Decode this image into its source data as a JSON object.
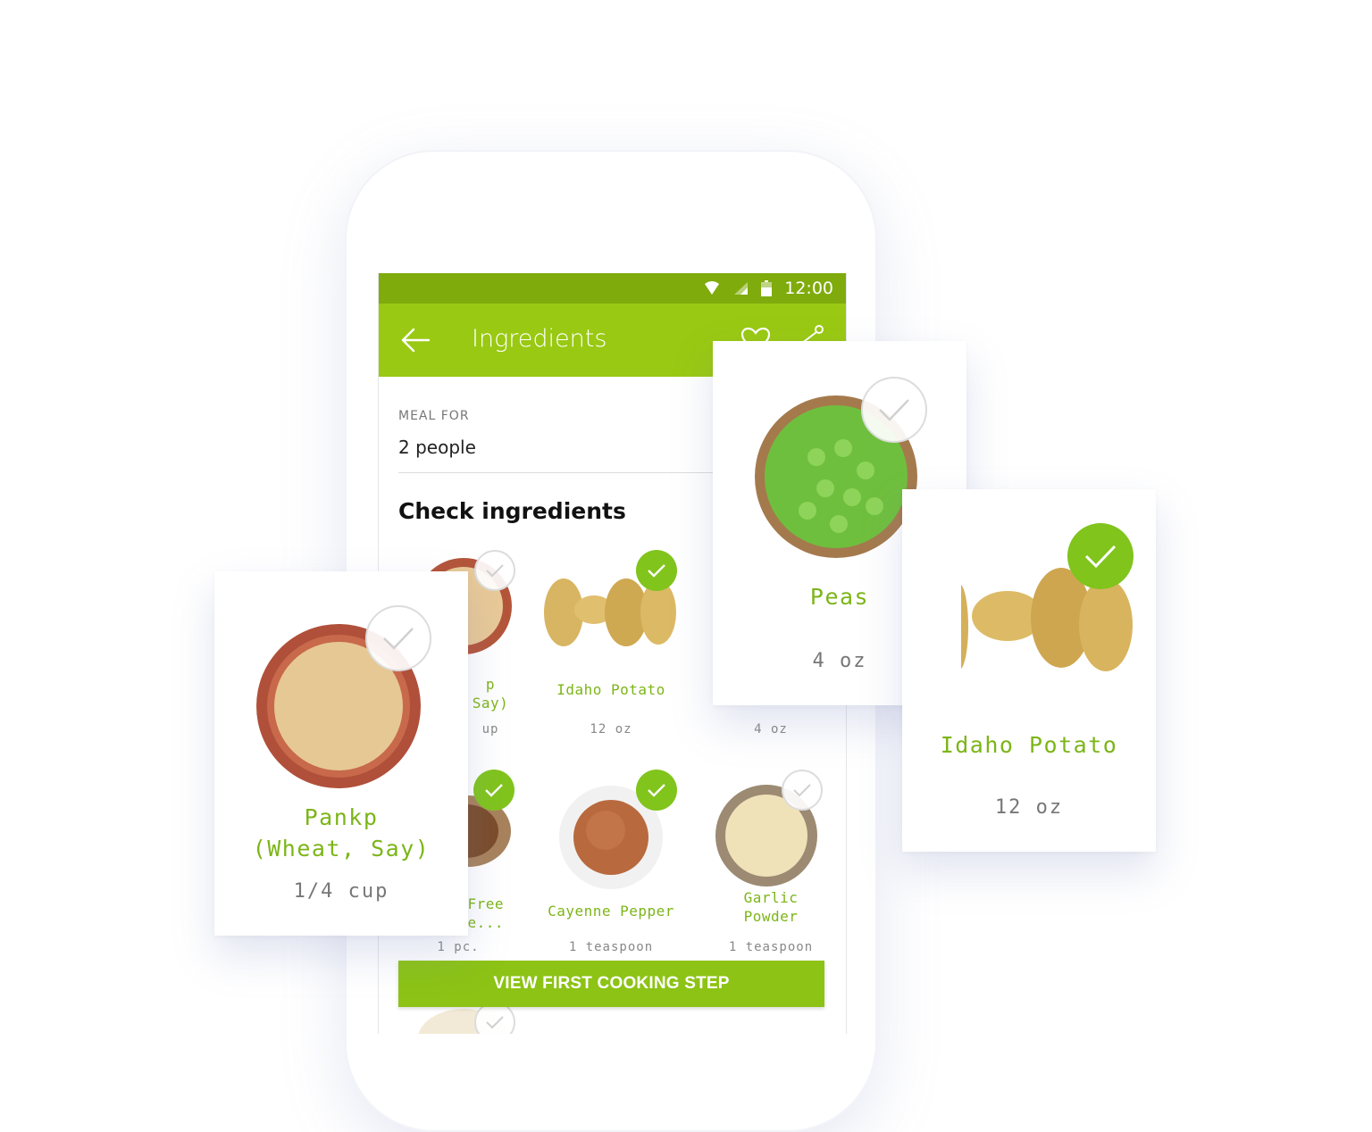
{
  "status_bar": {
    "time": "12:00"
  },
  "app_bar": {
    "title": "Ingredients"
  },
  "meal": {
    "label": "MEAL FOR",
    "value": "2 people"
  },
  "section_title": "Check ingredients",
  "grid_items": [
    {
      "name": "Pankp (Wheat, Say)",
      "qty": "1/4 cup",
      "checked": false
    },
    {
      "name": "Idaho Potato",
      "qty": "12 oz",
      "checked": true
    },
    {
      "name": "Peas",
      "qty": "4 oz",
      "checked": false
    },
    {
      "name": "Gluten Free Soy Sauce...",
      "qty": "1 pc.",
      "checked": true
    },
    {
      "name": "Cayenne Pepper",
      "qty": "1 teaspoon",
      "checked": true
    },
    {
      "name": "Garlic Powder",
      "qty": "1 teaspoon",
      "checked": false
    }
  ],
  "grid_text": {
    "pankp_name_line1": "p",
    "pankp_name_line2": "Say)",
    "pankp_qty": "up",
    "soy_name_line1": "Free",
    "soy_name_line2": "nce...",
    "garlic_line1": "Garlic",
    "garlic_line2": "Powder"
  },
  "cta_label": "VIEW FIRST COOKING STEP",
  "cards": {
    "pankp": {
      "name_line1": "Pankp",
      "name_line2": "(Wheat, Say)",
      "qty": "1/4 cup",
      "checked": false
    },
    "peas": {
      "name": "Peas",
      "qty": "4 oz",
      "checked": false
    },
    "potato": {
      "name": "Idaho Potato",
      "qty": "12 oz",
      "checked": true
    }
  },
  "colors": {
    "status_bar": "#7fab0c",
    "app_bar": "#99c912",
    "accent_green": "#7cb518",
    "check_on": "#80c41c"
  },
  "icons": [
    "back-arrow-icon",
    "heart-icon",
    "share-icon",
    "wifi-icon",
    "signal-icon",
    "battery-icon",
    "checkmark-icon"
  ]
}
